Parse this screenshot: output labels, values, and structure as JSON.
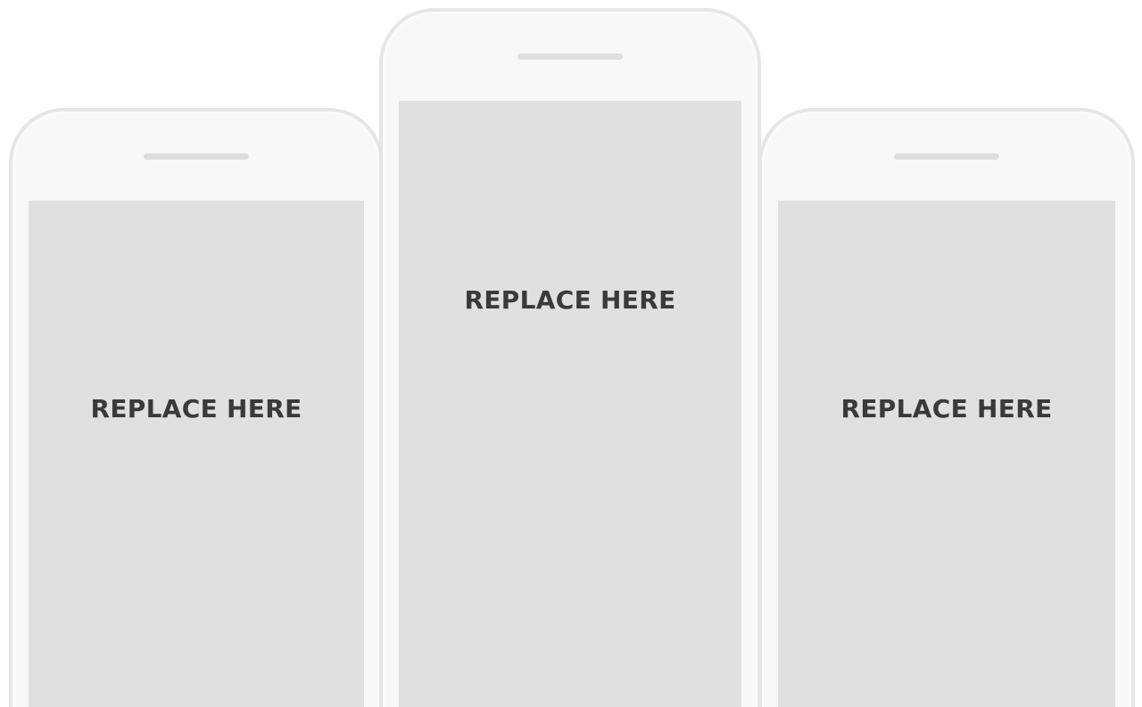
{
  "phones": [
    {
      "id": "left",
      "label": "REPLACE HERE"
    },
    {
      "id": "center",
      "label": "REPLACE HERE"
    },
    {
      "id": "right",
      "label": "REPLACE HERE"
    }
  ],
  "colors": {
    "background": "#ffffff",
    "phone_body": "#f8f8f8",
    "phone_border": "#e6e6e6",
    "screen": "#e0e0e0",
    "speaker": "#dedede",
    "label_text": "#3a3a3a"
  }
}
